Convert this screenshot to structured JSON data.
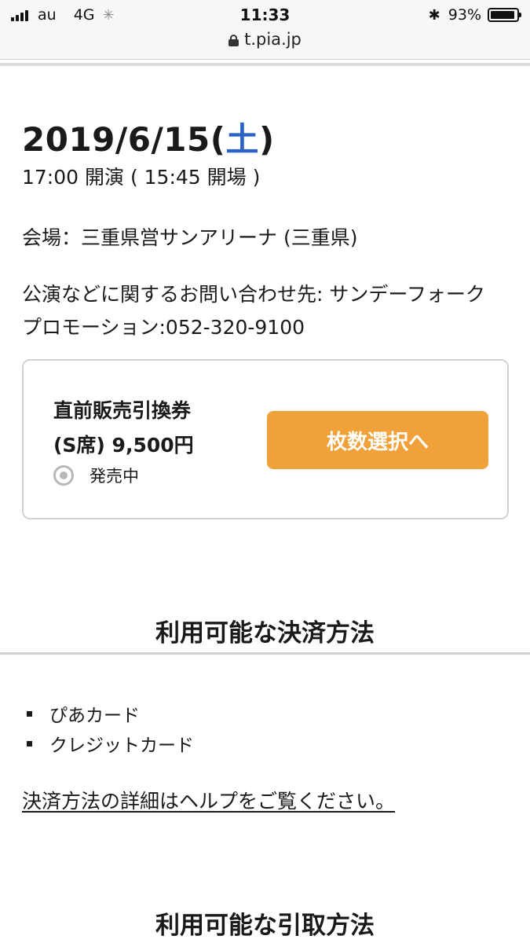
{
  "status_bar": {
    "carrier": "au",
    "network": "4G",
    "time": "11:33",
    "battery": "93%",
    "battery_level": 0.93
  },
  "url_bar": {
    "url": "t.pia.jp",
    "icon": "lock-icon"
  },
  "event": {
    "date_main": "2019/6/15(",
    "date_dow": "土",
    "date_close": ")",
    "time": "17:00 開演 ( 15:45 開場 )",
    "venue": "会場：三重県営サンアリーナ (三重県)",
    "contact": "公演などに関するお問い合わせ先: サンデーフォークプロモーション:052-320-9100"
  },
  "ticket": {
    "name": "直前販売引換券",
    "price": "(S席) 9,500円",
    "status_label": "発売中",
    "status_icon": "on-sale-circle-icon",
    "button_label": "枚数選択へ",
    "button_color": "#f0a13a"
  },
  "payment": {
    "heading": "利用可能な決済方法",
    "methods": [
      "ぴあカード",
      "クレジットカード"
    ],
    "help_link": "決済方法の詳細はヘルプをご覧ください。"
  },
  "pickup": {
    "heading": "利用可能な引取方法"
  },
  "colors": {
    "accent_blue": "#2a63c6",
    "button_orange": "#f0a13a"
  }
}
